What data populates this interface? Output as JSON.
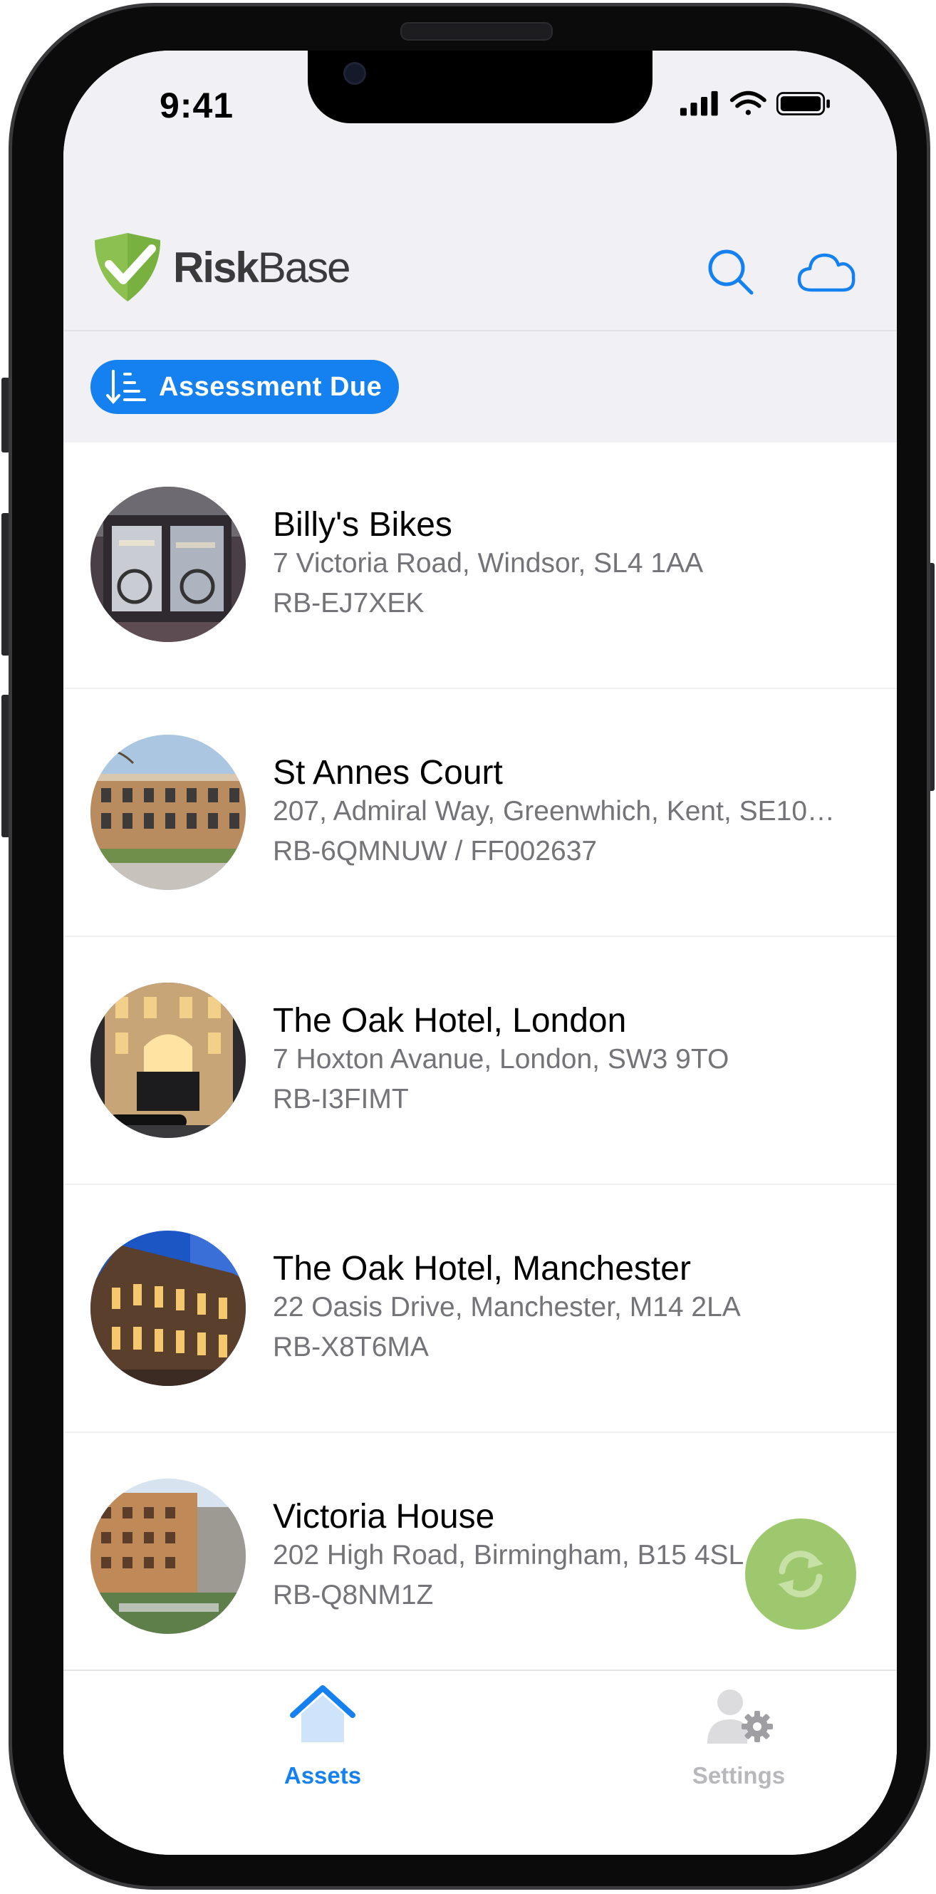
{
  "status_bar": {
    "time": "9:41"
  },
  "header": {
    "logo_text_bold": "Risk",
    "logo_text_regular": "Base",
    "search_icon": "search-icon",
    "cloud_icon": "cloud-icon"
  },
  "filter": {
    "label": "Assessment Due",
    "icon": "sort-descending-icon"
  },
  "assets": [
    {
      "title": "Billy's Bikes",
      "address": "7 Victoria Road, Windsor, SL4 1AA",
      "code": "RB-EJ7XEK"
    },
    {
      "title": "St Annes Court",
      "address": "207, Admiral Way, Greenwhich, Kent, SE10…",
      "code": "RB-6QMNUW / FF002637"
    },
    {
      "title": "The Oak Hotel, London",
      "address": "7 Hoxton Avanue, London, SW3 9TO",
      "code": "RB-I3FIMT"
    },
    {
      "title": "The Oak Hotel, Manchester",
      "address": "22 Oasis Drive, Manchester, M14 2LA",
      "code": "RB-X8T6MA"
    },
    {
      "title": "Victoria House",
      "address": "202 High Road, Birmingham, B15 4SL",
      "code": "RB-Q8NM1Z"
    }
  ],
  "fab": {
    "icon": "sync-icon"
  },
  "tabs": [
    {
      "label": "Assets",
      "icon": "home-icon",
      "active": true
    },
    {
      "label": "Settings",
      "icon": "user-settings-icon",
      "active": false
    }
  ],
  "colors": {
    "accent": "#1580F0",
    "logo_green": "#8CC152",
    "fab_green": "#9EC86E",
    "header_bg": "#F0F0F5",
    "secondary_text": "#737378",
    "inactive_tab": "#B8B8BC"
  }
}
